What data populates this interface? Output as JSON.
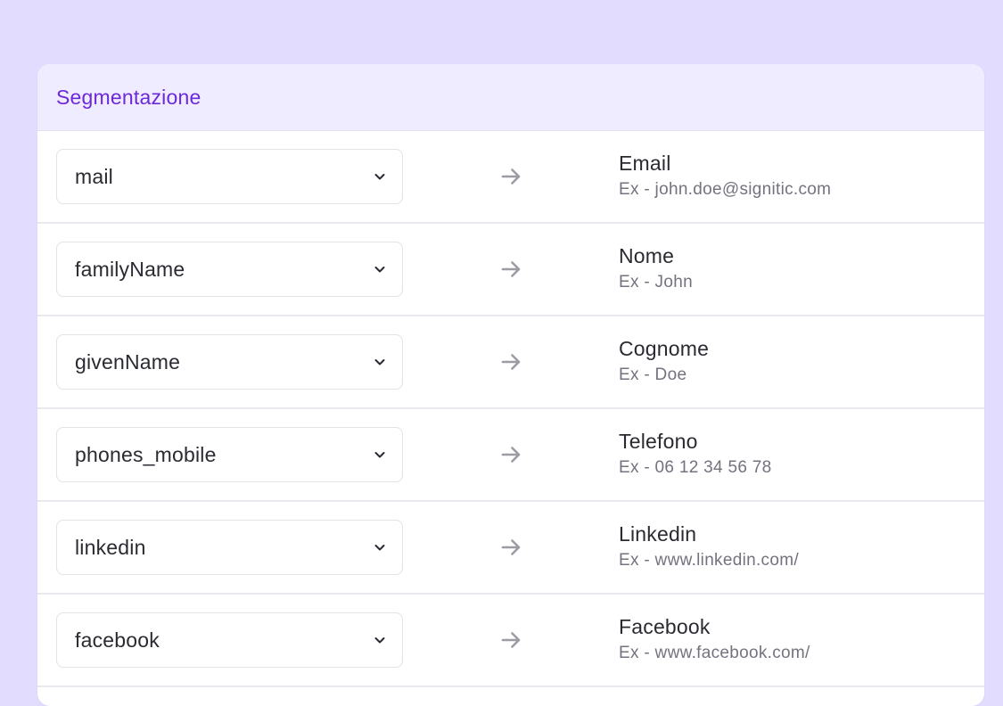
{
  "colors": {
    "page_background": "#e2dcff",
    "header_background": "#f0ecff",
    "title_accent": "#6d28d9",
    "arrow_gray": "#9c9ca6"
  },
  "panel": {
    "title": "Segmentazione"
  },
  "icons": {
    "dropdown": "chevron-down-icon",
    "mapping": "arrow-right-icon"
  },
  "rows": [
    {
      "source": "mail",
      "target": "Email",
      "example": "Ex - john.doe@signitic.com"
    },
    {
      "source": "familyName",
      "target": "Nome",
      "example": "Ex - John"
    },
    {
      "source": "givenName",
      "target": "Cognome",
      "example": "Ex - Doe"
    },
    {
      "source": "phones_mobile",
      "target": "Telefono",
      "example": "Ex - 06 12 34 56 78"
    },
    {
      "source": "linkedin",
      "target": "Linkedin",
      "example": "Ex - www.linkedin.com/"
    },
    {
      "source": "facebook",
      "target": "Facebook",
      "example": "Ex - www.facebook.com/"
    }
  ]
}
